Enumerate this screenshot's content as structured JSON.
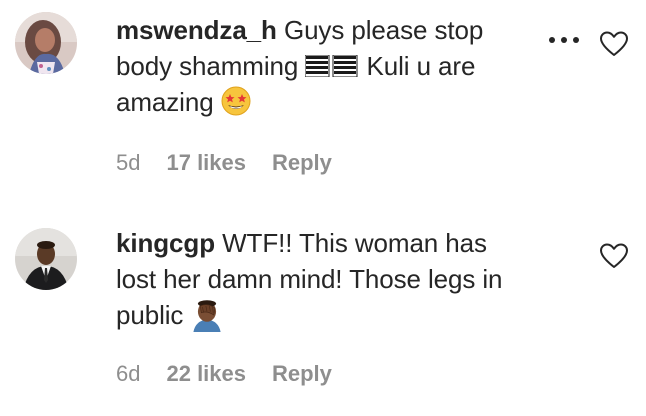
{
  "comments": [
    {
      "username": "mswendza_h",
      "text_line1": "Guys please stop",
      "text_line2a": "body shamming",
      "text_line2b": "Kuli u are",
      "text_line3": "amazing",
      "emoji_1": "black-bars-emoji",
      "emoji_2": "star-struck-emoji",
      "age": "5d",
      "likes": "17 likes",
      "reply_label": "Reply",
      "more_icon": "more-options-icon",
      "like_icon": "heart-outline-icon"
    },
    {
      "username": "kingcgp",
      "text_line1": "WTF!! This woman has",
      "text_line2": "lost her damn mind! Those legs in",
      "text_line3": "public",
      "emoji_1": "face-palm-emoji",
      "age": "6d",
      "likes": "22 likes",
      "reply_label": "Reply",
      "like_icon": "heart-outline-icon"
    }
  ],
  "colors": {
    "text": "#262626",
    "secondary": "#8e8e8e",
    "background": "#ffffff"
  }
}
